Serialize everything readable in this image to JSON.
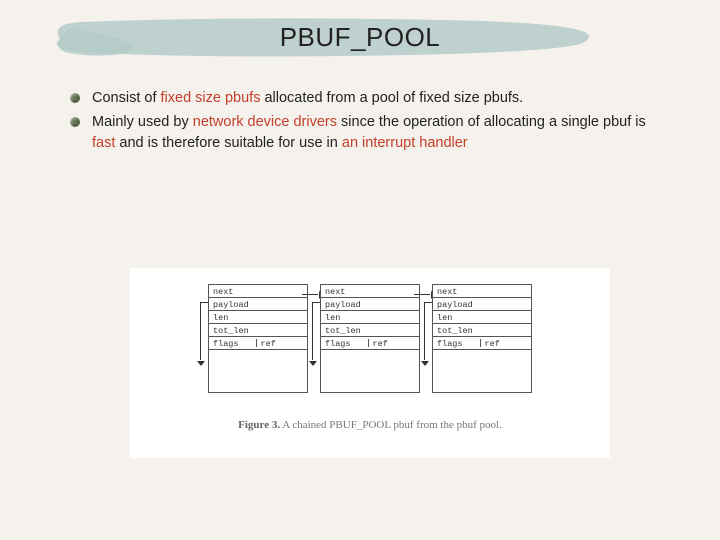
{
  "title": "PBUF_POOL",
  "bullets": [
    {
      "parts": [
        {
          "t": "Consist of "
        },
        {
          "t": "fixed size pbufs",
          "hl": true
        },
        {
          "t": " allocated from a pool of fixed size pbufs."
        }
      ]
    },
    {
      "parts": [
        {
          "t": "Mainly used by "
        },
        {
          "t": "network device drivers",
          "hl": true
        },
        {
          "t": " since the operation of allocating a single pbuf is "
        },
        {
          "t": "fast",
          "hl": true
        },
        {
          "t": " and is therefore suitable for use in "
        },
        {
          "t": "an interrupt handler",
          "hl": true
        }
      ]
    }
  ],
  "pbuf_fields": {
    "next": "next",
    "payload": "payload",
    "len": "len",
    "tot_len": "tot_len",
    "flags": "flags",
    "ref": "ref"
  },
  "caption_bold": "Figure 3.",
  "caption_rest": " A chained PBUF_POOL pbuf from the pbuf pool."
}
